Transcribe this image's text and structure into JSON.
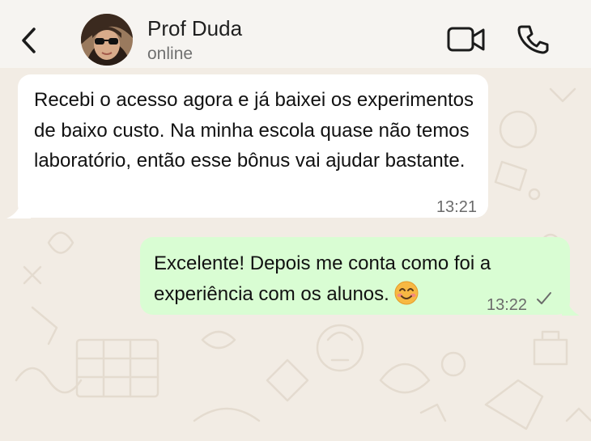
{
  "header": {
    "contact_name": "Prof Duda",
    "status": "online"
  },
  "messages": [
    {
      "direction": "incoming",
      "text": "Recebi o acesso agora e já baixei os experimentos de baixo custo. Na minha escola quase não temos laboratório, então esse bônus vai ajudar bastante.",
      "time": "13:21"
    },
    {
      "direction": "outgoing",
      "text": "Excelente! Depois me conta como foi a experiência com os alunos.",
      "emoji": "smiling-face-icon",
      "time": "13:22",
      "status_icon": "single-check-icon"
    }
  ],
  "colors": {
    "incoming_bubble": "#ffffff",
    "outgoing_bubble": "#d9fdd3",
    "chat_background": "#f2ece4",
    "header_background": "#f6f4f1"
  }
}
